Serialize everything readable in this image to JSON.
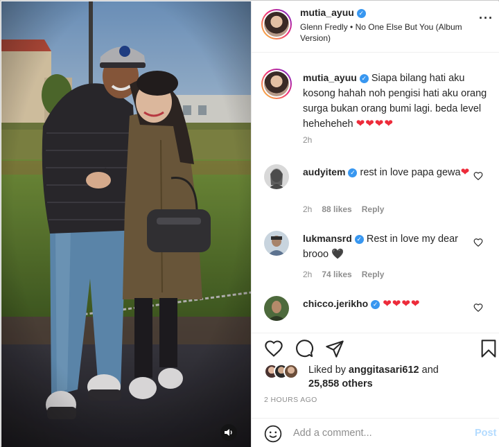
{
  "post": {
    "username": "mutia_ayuu",
    "audio": "Glenn Fredly • No One Else But You (Album Version)"
  },
  "caption": {
    "username": "mutia_ayuu",
    "text": "Siapa bilang hati aku kosong hahah noh pengisi hati aku orang surga bukan orang bumi lagi. beda level heheheheh",
    "hearts": "❤❤❤❤",
    "time": "2h"
  },
  "comments": [
    {
      "username": "audyitem",
      "text": "rest in love papa gewa",
      "emoji": "❤",
      "time": "2h",
      "likes": "88 likes",
      "reply": "Reply"
    },
    {
      "username": "lukmansrd",
      "text": "Rest in love my dear brooo",
      "emoji": "🖤",
      "time": "2h",
      "likes": "74 likes",
      "reply": "Reply"
    },
    {
      "username": "chicco.jerikho",
      "text": "",
      "emoji": "❤❤❤❤",
      "time": "",
      "likes": "",
      "reply": ""
    }
  ],
  "likes": {
    "liked_by_prefix": "Liked by",
    "liked_by_user": "anggitasari612",
    "and": "and",
    "others": "25,858 others"
  },
  "time_ago": "2 HOURS AGO",
  "add_comment": {
    "placeholder": "Add a comment...",
    "post_label": "Post"
  },
  "icons": {
    "more": "more-options-icon",
    "like": "heart-outline-icon",
    "comment": "comment-bubble-icon",
    "share": "paper-plane-icon",
    "save": "bookmark-icon",
    "emoji": "smiley-icon",
    "sound": "speaker-icon"
  },
  "colors": {
    "verified": "#3897f0",
    "heart": "#ed2b3a",
    "muted": "#8e8e8e",
    "post_button_disabled": "#b3dbff"
  }
}
